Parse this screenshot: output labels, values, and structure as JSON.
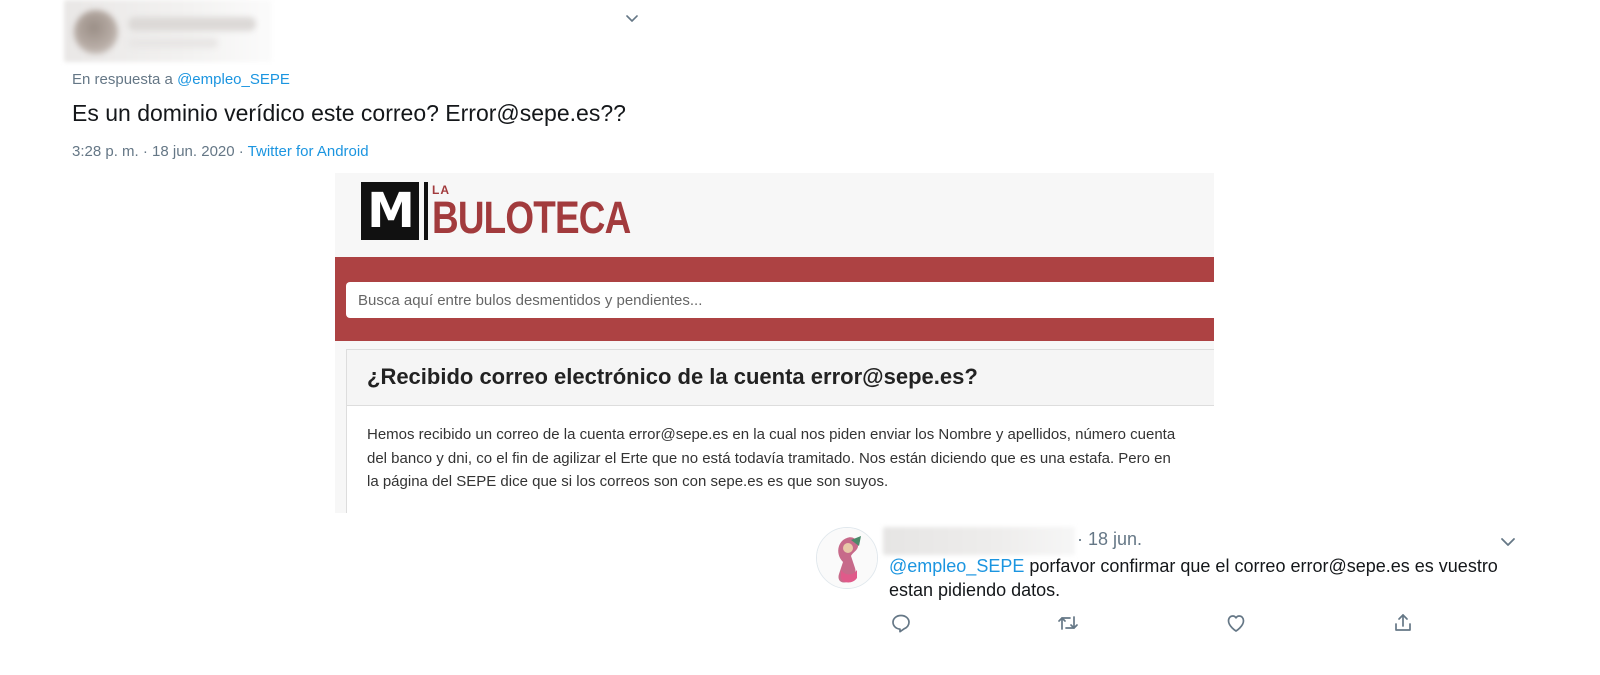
{
  "tweet1": {
    "reply_prefix": "En respuesta a ",
    "reply_mention": "@empleo_SEPE",
    "text": "Es un dominio verídico este correo? Error@sepe.es??",
    "time": "3:28 p. m. · 18 jun. 2020 · ",
    "source": "Twitter for Android"
  },
  "embedded": {
    "logo_letter": "M",
    "logo_la": "LA",
    "logo_name": "BULOTECA",
    "search_placeholder": "Busca aquí entre bulos desmentidos y pendientes...",
    "question_title": "¿Recibido correo electrónico de la cuenta error@sepe.es?",
    "question_body": "Hemos recibido un correo de la cuenta error@sepe.es en la cual nos piden enviar los Nombre y apellidos, número cuenta del banco y dni, co el fin de agilizar el Erte que no está todavía tramitado. Nos están diciendo que es una estafa. Pero en la página del SEPE dice que si los correos son con sepe.es es que son suyos."
  },
  "tweet2": {
    "date": "· 18 jun.",
    "mention": "@empleo_SEPE",
    "text": " porfavor confirmar que el correo error@sepe.es es vuestro estan pidiendo datos."
  },
  "colors": {
    "brand_red": "#ad4243",
    "logo_red": "#a23b3d",
    "link_blue": "#1b95e0",
    "meta_gray": "#657786"
  }
}
